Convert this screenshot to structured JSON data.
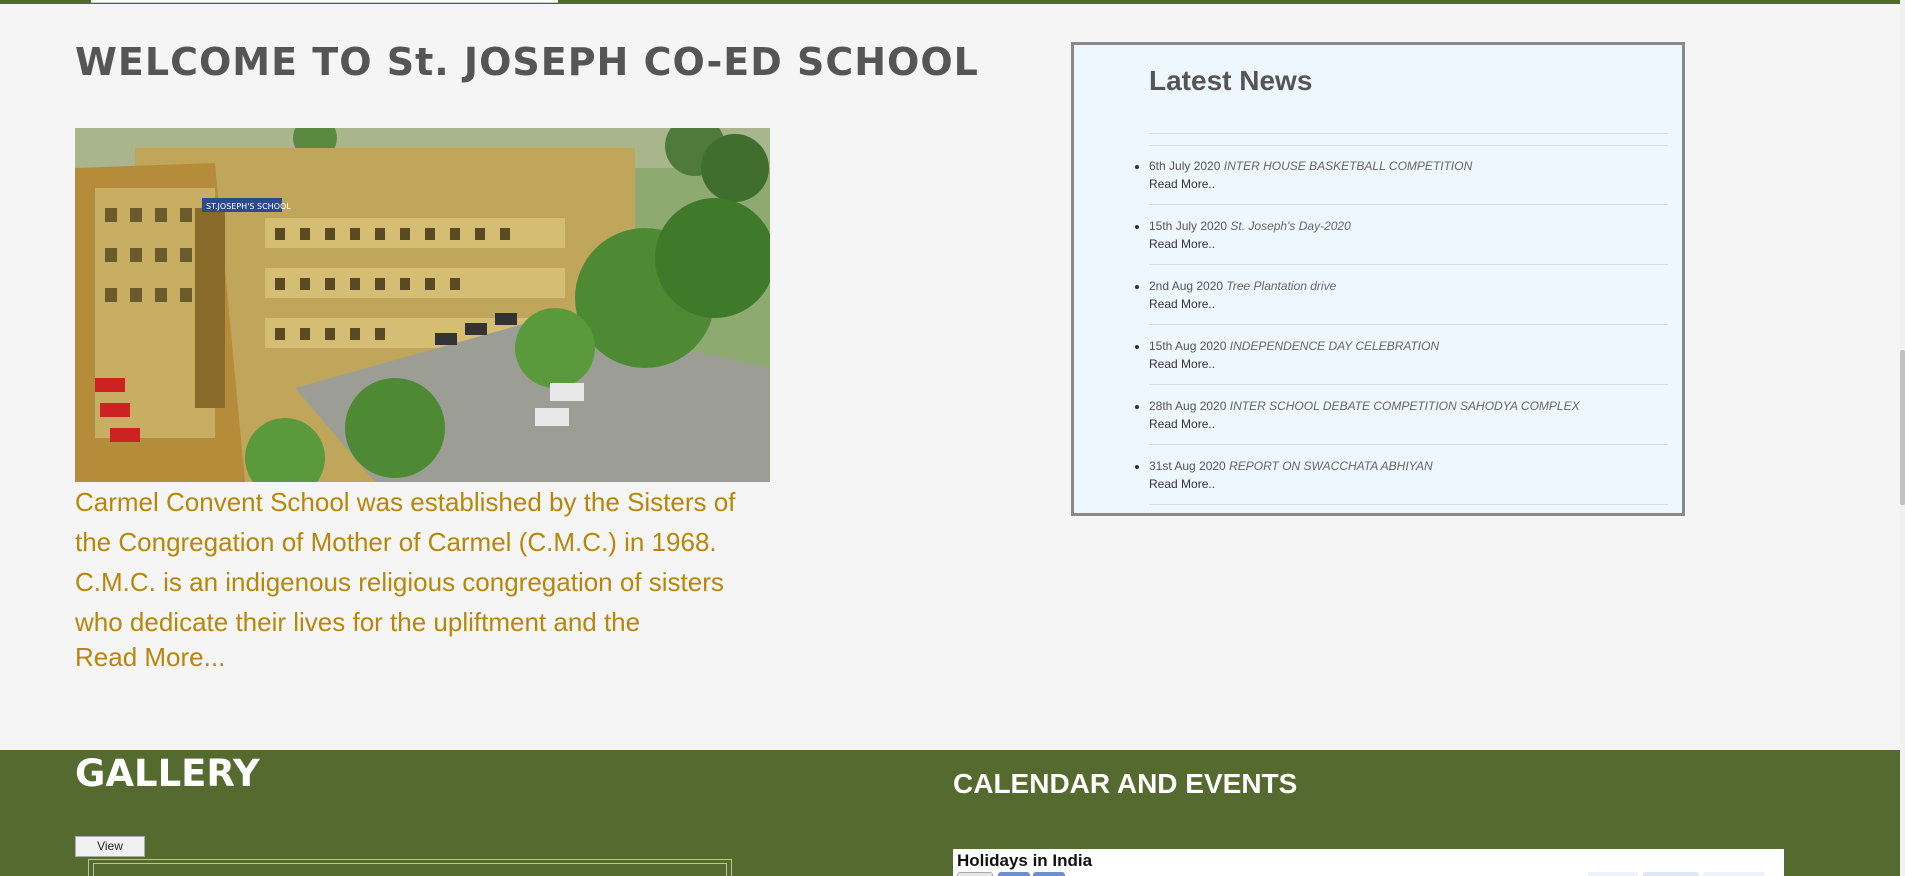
{
  "welcome": {
    "title": "WELCOME TO St. JOSEPH CO-ED SCHOOL",
    "photo_sign": "ST.JOSEPH'S SCHOOL",
    "paragraph_lines": [
      "Carmel Convent School was established by the Sisters of",
      "the Congregation of Mother of Carmel (C.M.C.) in 1968.",
      "C.M.C. is an indigenous religious congregation of sisters",
      "who dedicate their lives for the upliftment and the"
    ],
    "read_more": "Read More..."
  },
  "news": {
    "title": "Latest News",
    "items": [
      {
        "date": "6th July 2020",
        "name": "INTER HOUSE BASKETBALL COMPETITION",
        "more": "Read More.."
      },
      {
        "date": "15th July 2020",
        "name": "St. Joseph's Day-2020",
        "more": "Read More.."
      },
      {
        "date": "2nd Aug 2020",
        "name": "Tree Plantation drive",
        "more": "Read More.."
      },
      {
        "date": "15th Aug 2020",
        "name": "INDEPENDENCE DAY CELEBRATION",
        "more": "Read More.."
      },
      {
        "date": "28th Aug 2020",
        "name": "INTER SCHOOL DEBATE COMPETITION SAHODYA COMPLEX",
        "more": "Read More.."
      },
      {
        "date": "31st Aug 2020",
        "name": "REPORT ON SWACCHATA ABHIYAN",
        "more": "Read More.."
      }
    ]
  },
  "gallery": {
    "title": "GALLERY",
    "view_label": "View"
  },
  "calendar": {
    "title": "CALENDAR AND EVENTS",
    "widget_name": "Holidays in India"
  },
  "colors": {
    "band_green": "#546a2f",
    "welcome_text": "#b8860b",
    "news_bg": "#eef6fe"
  }
}
